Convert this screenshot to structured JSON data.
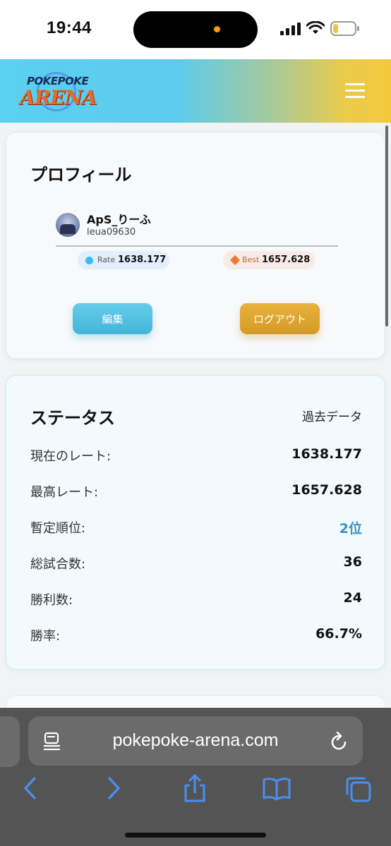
{
  "status_bar": {
    "time": "19:44"
  },
  "header": {
    "logo_top": "POKEPOKE",
    "logo_bottom": "ARENA"
  },
  "profile": {
    "title": "プロフィール",
    "username": "ApS_りーふ",
    "user_id": "leua09630",
    "rate_label": "Rate",
    "rate_value": "1638.177",
    "best_label": "Best",
    "best_value": "1657.628",
    "edit_label": "編集",
    "logout_label": "ログアウト"
  },
  "status": {
    "title": "ステータス",
    "past_data_label": "過去データ",
    "rows": [
      {
        "label": "現在のレート:",
        "value": "1638.177"
      },
      {
        "label": "最高レート:",
        "value": "1657.628"
      },
      {
        "label": "暫定順位:",
        "value": "2位"
      },
      {
        "label": "総試合数:",
        "value": "36"
      },
      {
        "label": "勝利数:",
        "value": "24"
      },
      {
        "label": "勝率:",
        "value": "66.7%"
      }
    ]
  },
  "browser": {
    "url": "pokepoke-arena.com"
  },
  "colors": {
    "accent_blue": "#43b4d9",
    "accent_gold": "#d49a27",
    "rank_blue": "#3b94c4"
  }
}
